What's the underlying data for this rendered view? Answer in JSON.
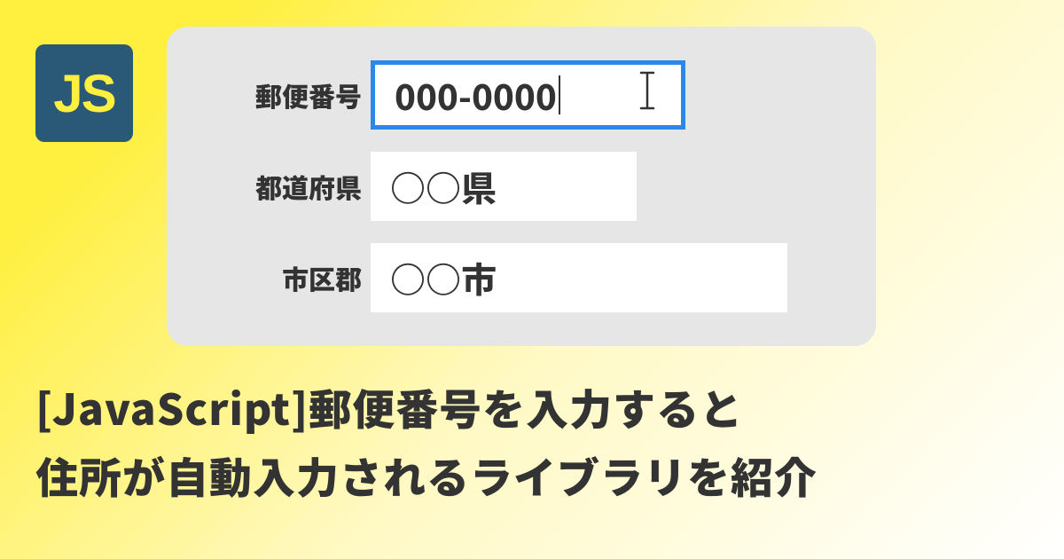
{
  "badge": {
    "text": "JS"
  },
  "form": {
    "postal": {
      "label": "郵便番号",
      "value": "000-0000"
    },
    "prefecture": {
      "label": "都道府県",
      "value": "○○県"
    },
    "city": {
      "label": "市区郡",
      "value": "○○市"
    }
  },
  "title": {
    "line1": "[JavaScript]郵便番号を入力すると",
    "line2": "住所が自動入力されるライブラリを紹介"
  }
}
